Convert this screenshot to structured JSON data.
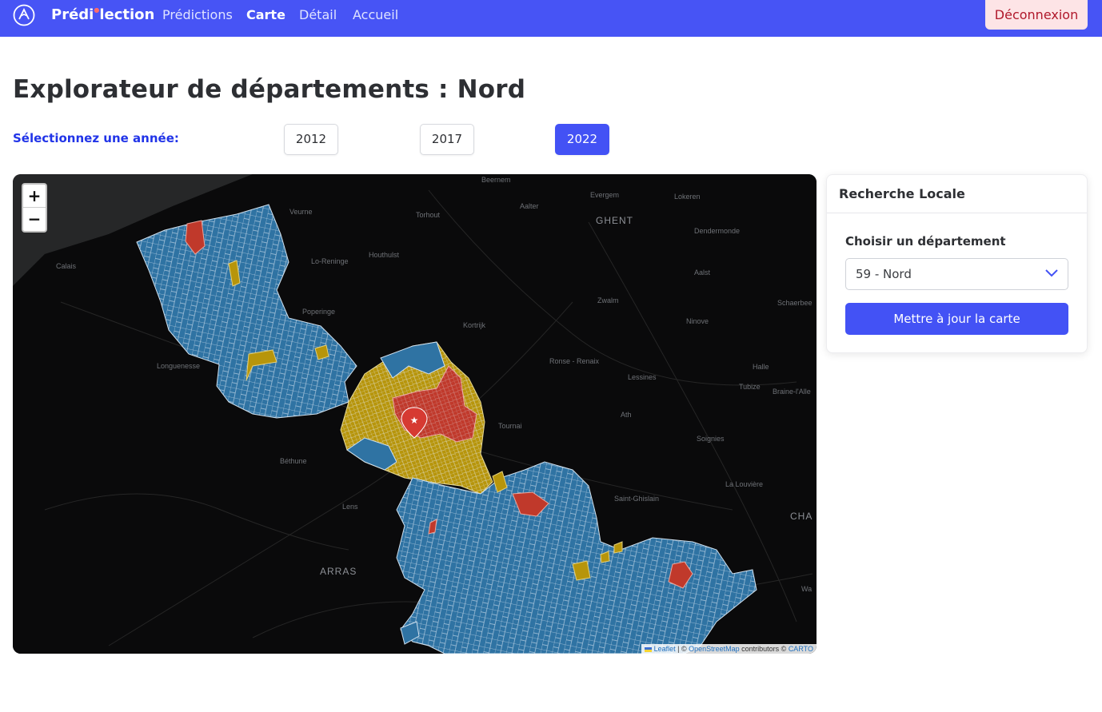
{
  "nav": {
    "brand_left": "Prédi",
    "brand_right": "lection",
    "links": [
      "Prédictions",
      "Carte",
      "Détail",
      "Accueil"
    ],
    "logout": "Déconnexion"
  },
  "page": {
    "title": "Explorateur de départements : Nord"
  },
  "years": {
    "label": "Sélectionnez une année:",
    "options": [
      "2012",
      "2017",
      "2022"
    ],
    "selected": "2022"
  },
  "map": {
    "zoom_in": "+",
    "zoom_out": "−",
    "attribution": {
      "leaflet": "Leaflet",
      "sep": " | © ",
      "osm": "OpenStreetMap",
      "contrib": " contributors © ",
      "carto": "CARTO"
    },
    "place_labels": [
      "Beernem",
      "Evergem",
      "Lokeren",
      "Aalter",
      "GHENT",
      "Veurne",
      "Torhout",
      "Dendermonde",
      "Calais",
      "Lo-Reninge",
      "Houthulst",
      "Aalst",
      "Zwalm",
      "Poperinge",
      "Kortrijk",
      "Schaerbee",
      "Ninove",
      "Longuenesse",
      "Ronse - Renaix",
      "Halle",
      "Lessines",
      "Tubize",
      "Braine-l'Alle",
      "Ath",
      "Tournai",
      "Soignies",
      "Béthune",
      "La Louvière",
      "Saint-Ghislain",
      "Lens",
      "CHA",
      "ARRAS",
      "Wa"
    ],
    "legend_colors": {
      "blue": "#2f73a3",
      "yellow": "#b7950b",
      "red": "#c0392b"
    }
  },
  "side": {
    "header": "Recherche Locale",
    "field_label": "Choisir un département",
    "selected_department": "59 - Nord",
    "update_button": "Mettre à jour la carte"
  }
}
